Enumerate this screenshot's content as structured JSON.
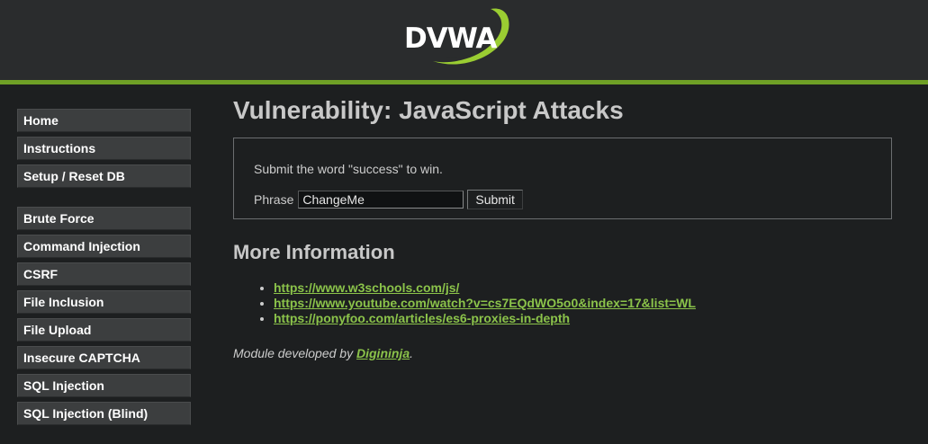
{
  "header": {
    "logo_text": "DVWA",
    "brand_color": "#6fa026"
  },
  "sidebar": {
    "groups": [
      {
        "items": [
          {
            "label": "Home"
          },
          {
            "label": "Instructions"
          },
          {
            "label": "Setup / Reset DB"
          }
        ]
      },
      {
        "items": [
          {
            "label": "Brute Force"
          },
          {
            "label": "Command Injection"
          },
          {
            "label": "CSRF"
          },
          {
            "label": "File Inclusion"
          },
          {
            "label": "File Upload"
          },
          {
            "label": "Insecure CAPTCHA"
          },
          {
            "label": "SQL Injection"
          },
          {
            "label": "SQL Injection (Blind)"
          }
        ]
      }
    ]
  },
  "main": {
    "title": "Vulnerability: JavaScript Attacks",
    "instruction": "Submit the word \"success\" to win.",
    "phrase_label": "Phrase",
    "phrase_value": "ChangeMe",
    "submit_label": "Submit",
    "more_info_heading": "More Information",
    "links": [
      {
        "text": "https://www.w3schools.com/js/"
      },
      {
        "text": "https://www.youtube.com/watch?v=cs7EQdWO5o0&index=17&list=WL"
      },
      {
        "text": "https://ponyfoo.com/articles/es6-proxies-in-depth"
      }
    ],
    "credit_prefix": "Module developed by ",
    "credit_author": "Digininja",
    "credit_suffix": ".",
    "link_color": "#8bc34a"
  }
}
